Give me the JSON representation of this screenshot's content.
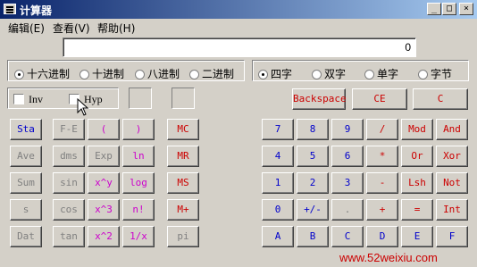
{
  "window": {
    "title": "计算器"
  },
  "title_buttons": {
    "minimize": "_",
    "maximize": "□",
    "close": "×"
  },
  "menu": [
    {
      "label": "编辑(E)"
    },
    {
      "label": "查看(V)"
    },
    {
      "label": "帮助(H)"
    }
  ],
  "display": {
    "value": "0"
  },
  "base_radios": [
    {
      "label": "十六进制",
      "selected": true
    },
    {
      "label": "十进制",
      "selected": false
    },
    {
      "label": "八进制",
      "selected": false
    },
    {
      "label": "二进制",
      "selected": false
    }
  ],
  "word_radios": [
    {
      "label": "四字",
      "selected": true
    },
    {
      "label": "双字",
      "selected": false
    },
    {
      "label": "单字",
      "selected": false
    },
    {
      "label": "字节",
      "selected": false
    }
  ],
  "checkboxes": {
    "inv": "Inv",
    "hyp": "Hyp"
  },
  "edit_buttons": {
    "backspace": "Backspace",
    "ce": "CE",
    "c": "C"
  },
  "stat_buttons": [
    "Sta",
    "Ave",
    "Sum",
    "s",
    "Dat"
  ],
  "sci_col1": [
    "F-E",
    "dms",
    "sin",
    "cos",
    "tan"
  ],
  "sci_col2": [
    "(",
    "Exp",
    "x^y",
    "x^3",
    "x^2"
  ],
  "sci_col3": [
    ")",
    "ln",
    "log",
    "n!",
    "1/x"
  ],
  "mem_buttons": [
    "MC",
    "MR",
    "MS",
    "M+",
    "pi"
  ],
  "keypad_rows": [
    [
      "7",
      "8",
      "9",
      "/",
      "Mod",
      "And"
    ],
    [
      "4",
      "5",
      "6",
      "*",
      "Or",
      "Xor"
    ],
    [
      "1",
      "2",
      "3",
      "-",
      "Lsh",
      "Not"
    ],
    [
      "0",
      "+/-",
      ".",
      "+",
      "=",
      "Int"
    ],
    [
      "A",
      "B",
      "C",
      "D",
      "E",
      "F"
    ]
  ],
  "colors": {
    "blue": "#0000cc",
    "red": "#cc0000",
    "magenta": "#cc00cc",
    "gray": "#808080"
  },
  "watermark": "www.52weixiu.com"
}
